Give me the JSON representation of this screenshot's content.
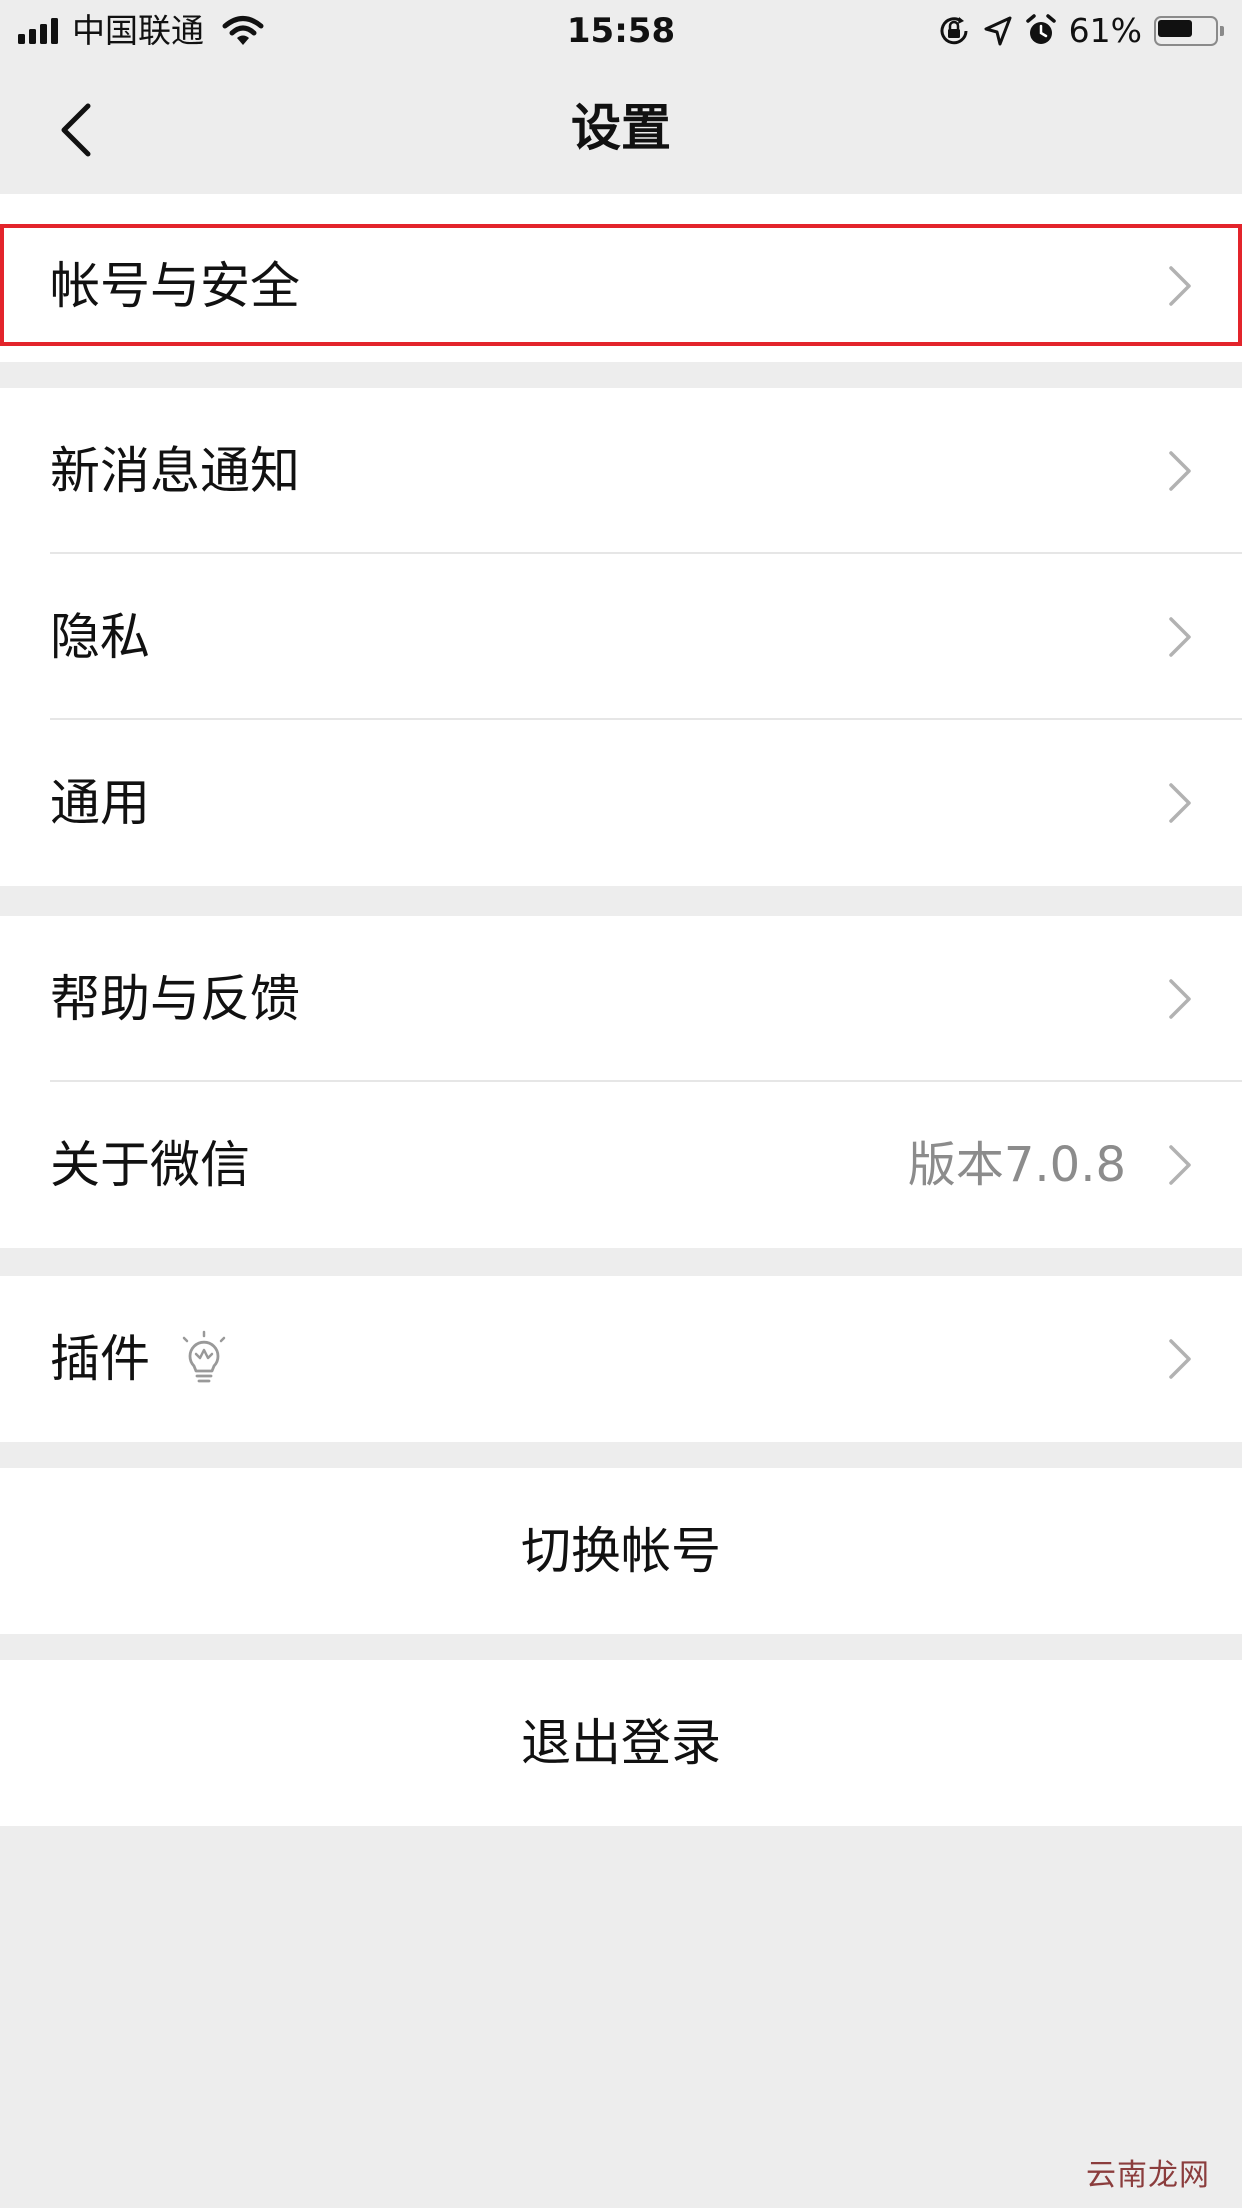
{
  "status_bar": {
    "carrier": "中国联通",
    "time": "15:58",
    "battery_percent": "61%",
    "battery_level": 0.61,
    "icons": [
      "signal-icon",
      "wifi-icon",
      "rotation-lock-icon",
      "location-icon",
      "alarm-icon",
      "battery-icon"
    ]
  },
  "nav": {
    "title": "设置",
    "back_icon": "chevron-left-icon"
  },
  "groups": {
    "account": {
      "items": [
        {
          "label": "帐号与安全",
          "highlighted": true
        }
      ]
    },
    "main": {
      "items": [
        {
          "label": "新消息通知"
        },
        {
          "label": "隐私"
        },
        {
          "label": "通用"
        }
      ]
    },
    "support": {
      "items": [
        {
          "label": "帮助与反馈"
        },
        {
          "label": "关于微信",
          "value": "版本7.0.8"
        }
      ]
    },
    "plugins": {
      "items": [
        {
          "label": "插件",
          "icon": "lightbulb-icon"
        }
      ]
    }
  },
  "actions": {
    "switch_account": "切换帐号",
    "logout": "退出登录"
  },
  "watermark": "云南龙网",
  "colors": {
    "background": "#ededed",
    "cell": "#ffffff",
    "highlight_border": "#e3242b",
    "secondary_text": "#8c8c8c"
  }
}
